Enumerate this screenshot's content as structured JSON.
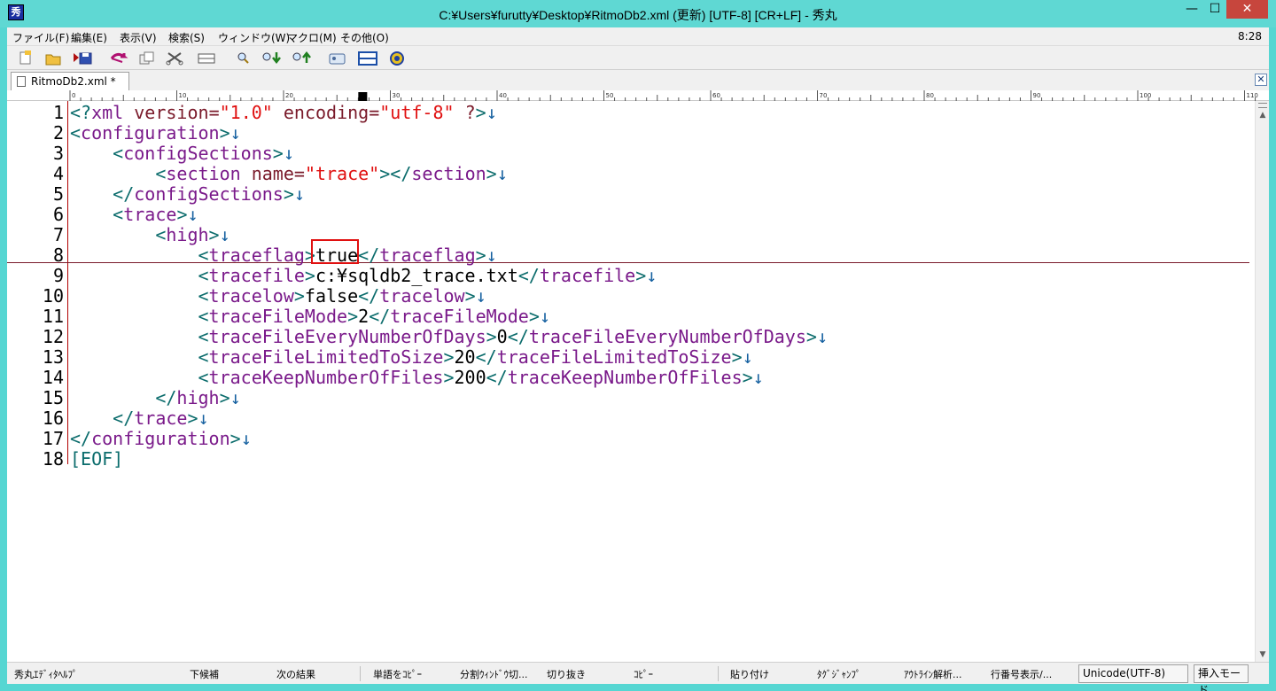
{
  "window": {
    "title": "C:¥Users¥furutty¥Desktop¥RitmoDb2.xml (更新) [UTF-8] [CR+LF] - 秀丸",
    "app_icon": "秀",
    "min": "—",
    "max": "☐",
    "close": "✕"
  },
  "menu": {
    "items": [
      "ファイル(F)",
      "編集(E)",
      "表示(V)",
      "検索(S)",
      "ウィンドウ(W)",
      "マクロ(M)",
      "その他(O)"
    ],
    "clock": "8:28"
  },
  "toolbar": {
    "icons": [
      "new-file-icon",
      "open-folder-icon",
      "save-icon",
      "undo-icon",
      "copy-icon",
      "cut-icon",
      "paste-icon",
      "search-icon",
      "search-down-icon",
      "search-up-icon",
      "grep-icon",
      "split-window-icon",
      "macro-icon"
    ]
  },
  "tab": {
    "label": "RitmoDb2.xml *",
    "close": "✕"
  },
  "ruler": {
    "marks": [
      "0",
      "10",
      "20",
      "30",
      "40",
      "50",
      "60",
      "70",
      "80",
      "90",
      "100",
      "110"
    ]
  },
  "editor": {
    "line_numbers": [
      "1",
      "2",
      "3",
      "4",
      "5",
      "6",
      "7",
      "8",
      "9",
      "10",
      "11",
      "12",
      "13",
      "14",
      "15",
      "16",
      "17",
      "18"
    ],
    "cursor_line": 8,
    "lines": [
      "<?xml version=\"1.0\" encoding=\"utf-8\" ?>↓",
      "<configuration>↓",
      "    <configSections>↓",
      "        <section name=\"trace\"></section>↓",
      "    </configSections>↓",
      "    <trace>↓",
      "        <high>↓",
      "            <traceflag>true</traceflag>↓",
      "            <tracefile>c:¥sqldb2_trace.txt</tracefile>↓",
      "            <tracelow>false</tracelow>↓",
      "            <traceFileMode>2</traceFileMode>↓",
      "            <traceFileEveryNumberOfDays>0</traceFileEveryNumberOfDays>↓",
      "            <traceFileLimitedToSize>20</traceFileLimitedToSize>↓",
      "            <traceKeepNumberOfFiles>200</traceKeepNumberOfFiles>↓",
      "        </high>↓",
      "    </trace>↓",
      "</configuration>↓",
      "[EOF]"
    ]
  },
  "statusbar": {
    "items": [
      "秀丸ｴﾃﾞｨﾀﾍﾙﾌﾟ",
      "下候補",
      "次の結果",
      "単語をｺﾋﾟｰ",
      "分割ｳｨﾝﾄﾞｳ切...",
      "切り抜き",
      "ｺﾋﾟｰ",
      "貼り付け",
      "ﾀｸﾞｼﾞｬﾝﾌﾟ",
      "ｱｳﾄﾗｲﾝ解析...",
      "行番号表示/..."
    ],
    "encoding": "Unicode(UTF-8)",
    "mode": "挿入モード"
  },
  "colors": {
    "window_frame": "#56d6d2",
    "tag_bracket": "#0b6c6c",
    "tag_name": "#7a1a8a",
    "attribute": "#7a1a2a",
    "string": "#e01010",
    "newline_mark": "#1560a0",
    "highlight_box": "#e01010"
  }
}
